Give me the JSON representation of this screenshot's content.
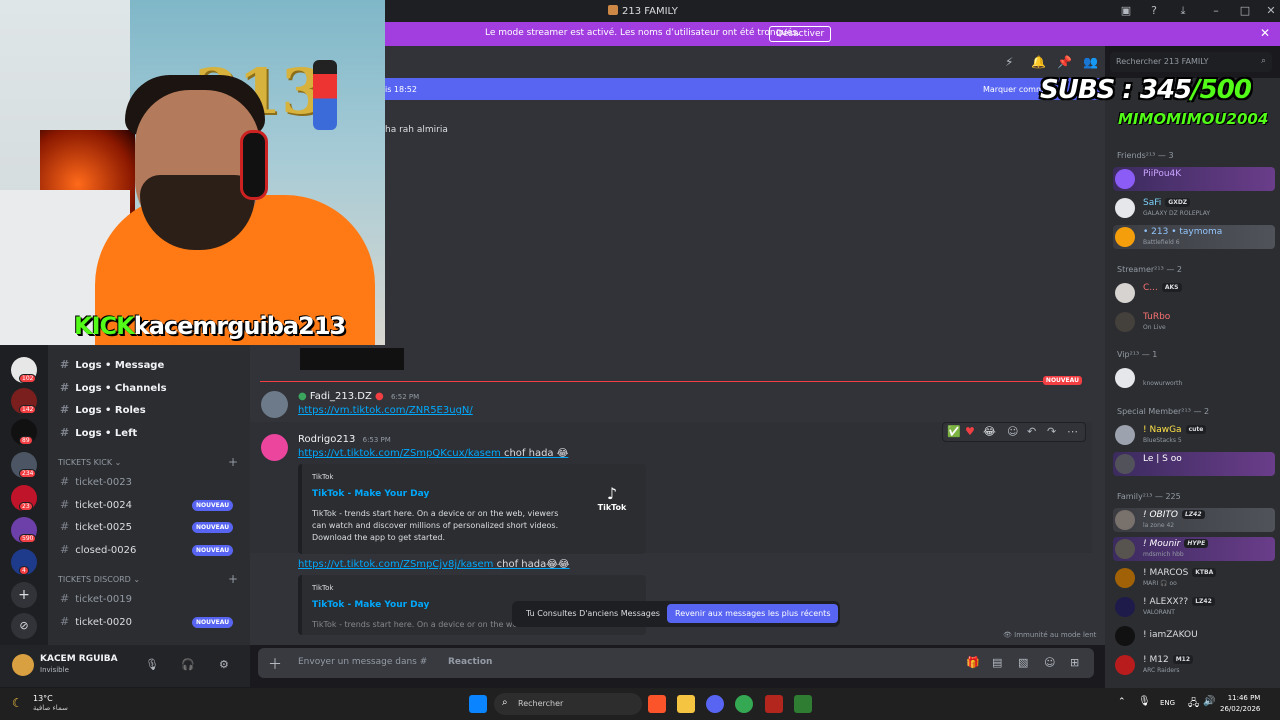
{
  "window": {
    "title": "213 FAMILY"
  },
  "banner": {
    "text": "Le mode streamer est activé. Les noms d’utilisateur ont été tronqués.",
    "button": "Désactiver"
  },
  "overlay": {
    "kick_label": "KICK",
    "kick_user": "kacemrguiba213",
    "subs_label": "SUBS : 345",
    "subs_total": "/500",
    "top_sub": "MIMOMIMOU2004"
  },
  "rail": {
    "badges": [
      "102",
      "142",
      "89",
      "234",
      "23",
      "590",
      "4"
    ]
  },
  "channels": {
    "items": [
      {
        "name": "Logs • Message"
      },
      {
        "name": "Logs • Channels"
      },
      {
        "name": "Logs • Roles"
      },
      {
        "name": "Logs • Left"
      }
    ],
    "cat_kick": "TICKETS KICK",
    "kick_tickets": [
      "ticket-0023",
      "ticket-0024",
      "ticket-0025",
      "closed-0026"
    ],
    "cat_discord": "TICKETS DISCORD",
    "discord_tickets": [
      "ticket-0019",
      "ticket-0020"
    ],
    "new_badge": "NOUVEAU"
  },
  "user": {
    "name": "KACEM RGUIBA",
    "status": "Invisible"
  },
  "header": {
    "search_placeholder": "Rechercher 213 FAMILY"
  },
  "chat": {
    "newbar_left": "is 18:52",
    "newbar_right": "Marquer comme",
    "old_message": "ha rah almiria",
    "divider_tag": "NOUVEAU",
    "messages": [
      {
        "author": "Fadi_213.DZ",
        "time": "6:52 PM",
        "link": "https://vm.tiktok.com/ZNR5E3ugN/"
      },
      {
        "author": "Rodrigo213",
        "time": "6:53 PM",
        "link": "https://vt.tiktok.com/ZSmpQKcux/kasem",
        "text": "chof hada 😂"
      },
      {
        "link": "https://vt.tiktok.com/ZSmpCjv8j/kasem",
        "text": "chof hada😂😂"
      }
    ],
    "embed": {
      "provider": "TikTok",
      "title": "TikTok - Make Your Day",
      "description": "TikTok - trends start here. On a device or on the web, viewers can watch and discover millions of personalized short videos. Download the app to get started.",
      "thumb_label": "TikTok",
      "partial_description": "TikTok - trends start here. On a device or on the web"
    },
    "old_pill": {
      "text": "Tu Consultes D'anciens Messages",
      "button": "Revenir aux messages les plus récents"
    },
    "slowmode": "Immunité au mode lent"
  },
  "composer": {
    "placeholder": "Envoyer un message dans #",
    "react": "Reaction"
  },
  "members": {
    "groups": [
      {
        "role": "Friends²¹³ — 3"
      },
      {
        "role": "Streamer²¹³ — 2"
      },
      {
        "role": "Vip²¹³ — 1"
      },
      {
        "role": "Special Member²¹³ — 2"
      },
      {
        "role": "Family²¹³ — 225"
      }
    ],
    "list": [
      {
        "name": "PiiPou4K",
        "sub": ""
      },
      {
        "name": "SaFi",
        "tag": "GXDZ",
        "sub": "GALAXY DZ ROLEPLAY"
      },
      {
        "name": "• 213 • taymoma",
        "sub": "Battlefield 6"
      },
      {
        "name": "C...",
        "tag": "AKS",
        "sub": ""
      },
      {
        "name": "TuRbo",
        "sub": "On Live"
      },
      {
        "name": "",
        "sub": "knowurworth"
      },
      {
        "name": "! NawGa",
        "tag": "cute",
        "sub": "BlueStacks 5"
      },
      {
        "name": "Le | S oo",
        "sub": ""
      },
      {
        "name": "! OBITO",
        "tag": "LZ42",
        "sub": "la zone 42"
      },
      {
        "name": "! Mounir",
        "tag": "HYPE",
        "sub": "mdsmich hbb"
      },
      {
        "name": "! MARCOS",
        "tag": "KTBA",
        "sub": "MARI 🎧 oo"
      },
      {
        "name": "! ALEXX??",
        "tag": "LZ42",
        "sub": "VALORANT"
      },
      {
        "name": "! iamZAKOU",
        "sub": ""
      },
      {
        "name": "! M12",
        "tag": "M12",
        "sub": "ARC Raiders"
      }
    ]
  },
  "taskbar": {
    "temp": "13°C",
    "condition": "سماء صافية",
    "search": "Rechercher",
    "lang": "ENG",
    "time": "11:46 PM",
    "date": "26/02/2026"
  }
}
